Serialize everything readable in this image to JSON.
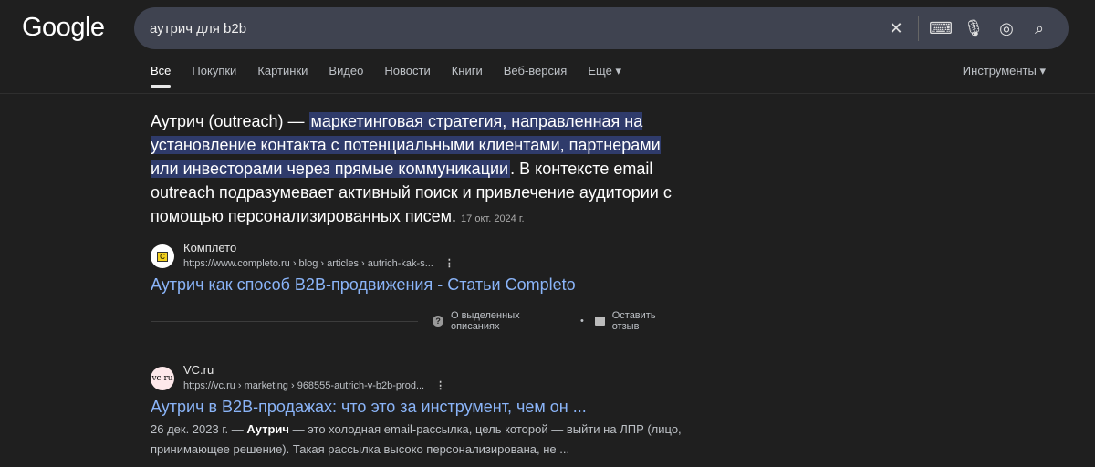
{
  "header": {
    "logo": "Google",
    "query": "аутрич для b2b"
  },
  "tabs": [
    "Все",
    "Покупки",
    "Картинки",
    "Видео",
    "Новости",
    "Книги",
    "Веб-версия",
    "Ещё ▾"
  ],
  "tools": "Инструменты ▾",
  "featured": {
    "pre": "Аутрич (outreach) — ",
    "highlight": "маркетинговая стратегия, направленная на установление контакта с потенциальными клиентами, партнерами или инвесторами через прямые коммуникации",
    "post": ". В контексте email outreach подразумевает активный поиск и привлечение аудитории с помощью персонализированных писем.",
    "date": "17 окт. 2024 г.",
    "site": "Комплето",
    "favicon": "C",
    "url": "https://www.completo.ru › blog › articles › autrich-kak-s...",
    "title": "Аутрич как способ B2B-продвижения - Статьи Completo"
  },
  "feedback": {
    "about": "О выделенных описаниях",
    "bullet": "•",
    "leave": "Оставить отзыв"
  },
  "result2": {
    "site": "VC.ru",
    "favicon": "vc ru",
    "url": "https://vc.ru › marketing › 968555-autrich-v-b2b-prod...",
    "title": "Аутрич в B2B-продажах: что это за инструмент, чем он ...",
    "date": "26 дек. 2023 г. — ",
    "bold": "Аутрич",
    "desc": " — это холодная email-рассылка, цель которой — выйти на ЛПР (лицо, принимающее решение). Такая рассылка высоко персонализирована, не ..."
  }
}
